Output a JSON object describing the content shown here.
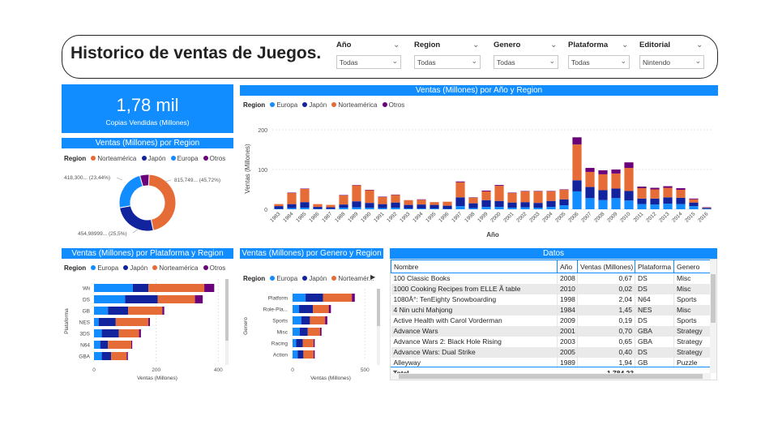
{
  "header": {
    "title": "Historico de ventas de Juegos."
  },
  "slicers": [
    {
      "label": "Año",
      "value": "Todas"
    },
    {
      "label": "Region",
      "value": "Todas"
    },
    {
      "label": "Genero",
      "value": "Todas"
    },
    {
      "label": "Plataforma",
      "value": "Todas"
    },
    {
      "label": "Editorial",
      "value": "Nintendo"
    }
  ],
  "kpi": {
    "value": "1,78 mil",
    "label": "Copias Vendidas (Millones)"
  },
  "colors": {
    "accent": "#118dff",
    "europa": "#118dff",
    "japon": "#12239e",
    "norteamerica": "#e66c37",
    "otros": "#6b007b"
  },
  "donut": {
    "title": "Ventas (Millones) por Region",
    "legend_title": "Region",
    "legend": [
      "Norteamérica",
      "Japón",
      "Europa",
      "Otros"
    ],
    "labels": {
      "norteamerica": "815,749... (45,72%)",
      "japon": "454,98999... (25,5%)",
      "europa": "418,300... (23,44%)"
    },
    "chart_data": {
      "type": "pie",
      "slices": [
        {
          "name": "Norteamérica",
          "value": 815.749,
          "percent": 45.72
        },
        {
          "name": "Japón",
          "value": 454.99,
          "percent": 25.5
        },
        {
          "name": "Europa",
          "value": 418.3,
          "percent": 23.44
        },
        {
          "name": "Otros",
          "value": 95.2,
          "percent": 5.34
        }
      ]
    }
  },
  "year_chart": {
    "title": "Ventas (Millones) por Año y Region",
    "legend_title": "Region",
    "legend": [
      "Europa",
      "Japón",
      "Norteamérica",
      "Otros"
    ],
    "xlabel": "Año",
    "ylabel": "Ventas (Millones)",
    "chart_data": {
      "type": "bar",
      "stacked": true,
      "categories": [
        "1983",
        "1984",
        "1985",
        "1986",
        "1987",
        "1988",
        "1989",
        "1990",
        "1991",
        "1992",
        "1993",
        "1994",
        "1995",
        "1996",
        "1997",
        "1998",
        "1999",
        "2000",
        "2001",
        "2002",
        "2003",
        "2004",
        "2005",
        "2006",
        "2007",
        "2008",
        "2009",
        "2010",
        "2011",
        "2012",
        "2013",
        "2014",
        "2015",
        "2016"
      ],
      "ylim": [
        0,
        200
      ],
      "yticks": [
        0,
        100,
        200
      ],
      "series": [
        {
          "name": "Europa",
          "values": [
            1,
            3,
            4,
            1,
            1,
            4,
            5,
            4,
            3,
            4,
            2,
            2,
            2,
            1,
            8,
            3,
            6,
            6,
            4,
            5,
            4,
            6,
            10,
            45,
            28,
            23,
            28,
            22,
            13,
            12,
            14,
            13,
            8,
            1
          ]
        },
        {
          "name": "Japón",
          "values": [
            7,
            10,
            14,
            5,
            4,
            8,
            15,
            12,
            10,
            13,
            9,
            10,
            9,
            8,
            22,
            12,
            17,
            15,
            13,
            13,
            12,
            15,
            15,
            28,
            28,
            25,
            24,
            24,
            14,
            15,
            16,
            16,
            9,
            2
          ]
        },
        {
          "name": "Norteamérica",
          "values": [
            5,
            28,
            33,
            7,
            6,
            23,
            40,
            32,
            18,
            19,
            12,
            12,
            7,
            10,
            38,
            14,
            22,
            38,
            24,
            27,
            29,
            24,
            24,
            90,
            38,
            40,
            38,
            58,
            26,
            23,
            24,
            20,
            8,
            1
          ]
        },
        {
          "name": "Otros",
          "values": [
            0,
            1,
            1,
            0,
            0,
            1,
            1,
            1,
            1,
            1,
            0,
            1,
            0,
            0,
            2,
            1,
            2,
            2,
            1,
            1,
            1,
            1,
            1,
            18,
            10,
            10,
            10,
            14,
            4,
            4,
            4,
            4,
            2,
            1
          ]
        }
      ]
    }
  },
  "platform_chart": {
    "title": "Ventas (Millones) por Plataforma y Region",
    "legend_title": "Region",
    "legend": [
      "Europa",
      "Japón",
      "Norteamérica",
      "Otros"
    ],
    "xlabel": "Ventas (Millones)",
    "ylabel": "Plataforma",
    "chart_data": {
      "type": "bar",
      "orientation": "horizontal",
      "stacked": true,
      "categories": [
        "Wii",
        "DS",
        "GB",
        "NES",
        "3DS",
        "N64",
        "GBA"
      ],
      "xlim": [
        0,
        420
      ],
      "xticks": [
        0,
        200,
        400
      ],
      "series": [
        {
          "name": "Europa",
          "values": [
            125,
            100,
            45,
            15,
            25,
            20,
            25
          ]
        },
        {
          "name": "Japón",
          "values": [
            50,
            105,
            65,
            55,
            55,
            25,
            30
          ]
        },
        {
          "name": "Norteamérica",
          "values": [
            180,
            120,
            110,
            105,
            65,
            75,
            50
          ]
        },
        {
          "name": "Otros",
          "values": [
            32,
            25,
            6,
            5,
            6,
            3,
            4
          ]
        }
      ]
    }
  },
  "genre_chart": {
    "title": "Ventas (Millones) por Genero y Region",
    "legend_title": "Region",
    "legend": [
      "Europa",
      "Japón",
      "Norteamér..."
    ],
    "xlabel": "Ventas (Millones)",
    "ylabel": "Genero",
    "chart_data": {
      "type": "bar",
      "orientation": "horizontal",
      "stacked": true,
      "categories": [
        "Platform",
        "Role-Pla...",
        "Sports",
        "Misc",
        "Racing",
        "Action"
      ],
      "xlim": [
        0,
        560
      ],
      "xticks": [
        0,
        500
      ],
      "series": [
        {
          "name": "Europa",
          "values": [
            90,
            45,
            60,
            50,
            25,
            35
          ]
        },
        {
          "name": "Japón",
          "values": [
            120,
            95,
            60,
            55,
            45,
            40
          ]
        },
        {
          "name": "Norteamérica",
          "values": [
            200,
            110,
            105,
            85,
            75,
            70
          ]
        },
        {
          "name": "Otros",
          "values": [
            20,
            15,
            15,
            10,
            8,
            8
          ]
        }
      ]
    }
  },
  "table": {
    "title": "Datos",
    "columns": [
      "Nombre",
      "Año",
      "Ventas (Millones)",
      "Plataforma",
      "Genero"
    ],
    "rows": [
      [
        "100 Classic Books",
        "2008",
        "0,67",
        "DS",
        "Misc"
      ],
      [
        "1000 Cooking Recipes from ELLE Ã  table",
        "2010",
        "0,02",
        "DS",
        "Misc"
      ],
      [
        "1080Â°: TenEighty Snowboarding",
        "1998",
        "2,04",
        "N64",
        "Sports"
      ],
      [
        "4 Nin uchi Mahjong",
        "1984",
        "1,45",
        "NES",
        "Misc"
      ],
      [
        "Active Health with Carol Vorderman",
        "2009",
        "0,19",
        "DS",
        "Sports"
      ],
      [
        "Advance Wars",
        "2001",
        "0,70",
        "GBA",
        "Strategy"
      ],
      [
        "Advance Wars 2: Black Hole Rising",
        "2003",
        "0,65",
        "GBA",
        "Strategy"
      ],
      [
        "Advance Wars: Dual Strike",
        "2005",
        "0,40",
        "DS",
        "Strategy"
      ],
      [
        "Alleyway",
        "1989",
        "1,94",
        "GB",
        "Puzzle"
      ]
    ],
    "total_label": "Total",
    "total_value": "1.784,23"
  }
}
